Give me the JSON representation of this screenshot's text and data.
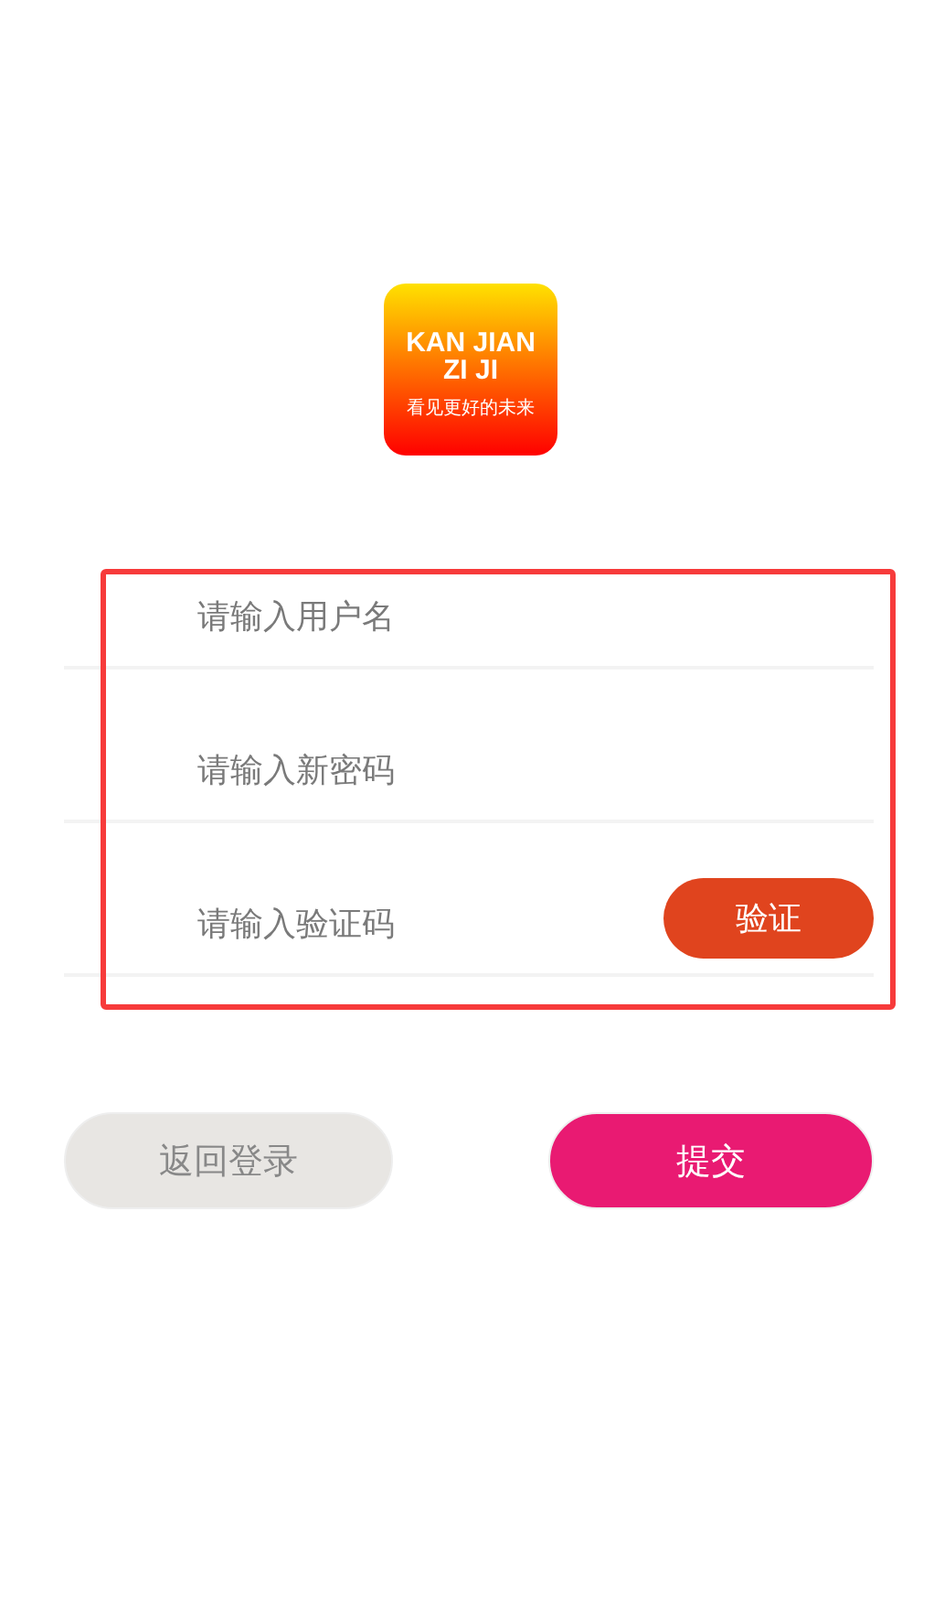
{
  "logo": {
    "lines": [
      "KAN JIAN",
      "ZI JI"
    ],
    "slogan": "看见更好的未来"
  },
  "fields": [
    {
      "placeholder": "请输入用户名"
    },
    {
      "placeholder": "请输入新密码"
    },
    {
      "placeholder": "请输入验证码",
      "button": "验证"
    }
  ],
  "buttons": [
    {
      "label": "返回登录",
      "kind": "secondary"
    },
    {
      "label": "提交",
      "kind": "primary"
    }
  ]
}
